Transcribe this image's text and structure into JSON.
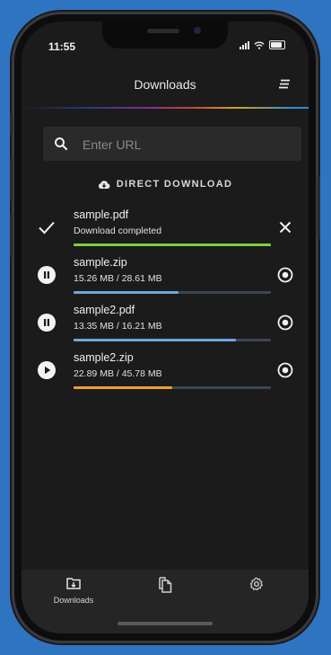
{
  "status": {
    "time": "11:55"
  },
  "header": {
    "title": "Downloads",
    "menu_icon": "menu-icon"
  },
  "search": {
    "placeholder": "Enter URL",
    "value": ""
  },
  "direct_download": {
    "label": "DIRECT DOWNLOAD",
    "icon": "cloud-download-icon"
  },
  "downloads": [
    {
      "name": "sample.pdf",
      "status": "Download completed",
      "progress": 1.0,
      "color": "#7ed040",
      "state": "completed",
      "left_icon": "checkmark-icon",
      "right_icon": "close-icon"
    },
    {
      "name": "sample.zip",
      "status": "15.26 MB / 28.61 MB",
      "progress": 0.533,
      "color": "#6aa8e0",
      "state": "paused",
      "left_icon": "pause-icon",
      "right_icon": "stop-icon"
    },
    {
      "name": "sample2.pdf",
      "status": "13.35 MB / 16.21 MB",
      "progress": 0.824,
      "color": "#6aa8e0",
      "state": "paused",
      "left_icon": "pause-icon",
      "right_icon": "stop-icon"
    },
    {
      "name": "sample2.zip",
      "status": "22.89 MB / 45.78 MB",
      "progress": 0.5,
      "color": "#f0a030",
      "state": "stopped",
      "left_icon": "play-icon",
      "right_icon": "stop-icon"
    }
  ],
  "tabs": [
    {
      "label": "Downloads",
      "icon": "folder-download-icon",
      "active": true
    },
    {
      "label": "",
      "icon": "files-icon",
      "active": false
    },
    {
      "label": "",
      "icon": "gear-icon",
      "active": false
    }
  ]
}
